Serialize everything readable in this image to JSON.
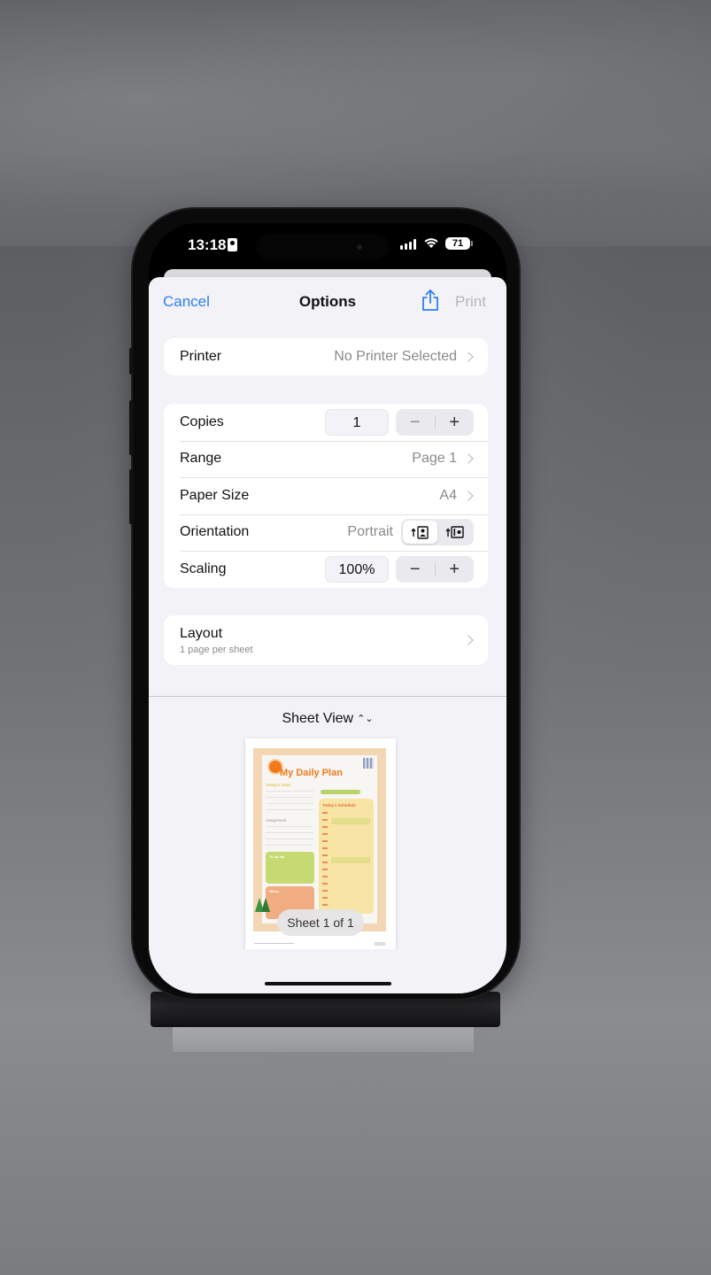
{
  "status_bar": {
    "time": "13:18",
    "battery": "71"
  },
  "nav": {
    "cancel_label": "Cancel",
    "title": "Options",
    "print_label": "Print"
  },
  "printer": {
    "label": "Printer",
    "value": "No Printer Selected"
  },
  "settings": {
    "copies_label": "Copies",
    "copies_value": "1",
    "range_label": "Range",
    "range_value": "Page 1",
    "paper_size_label": "Paper Size",
    "paper_size_value": "A4",
    "orientation_label": "Orientation",
    "orientation_value": "Portrait",
    "scaling_label": "Scaling",
    "scaling_value": "100%",
    "minus_symbol": "−",
    "plus_symbol": "+"
  },
  "layout": {
    "title": "Layout",
    "subtitle": "1 page per sheet"
  },
  "preview": {
    "view_mode": "Sheet View",
    "view_mode_icon": "⌃⌄",
    "document_title": "My Daily Plan",
    "goal_label": "Today's Goal",
    "assignment_label": "Assignment",
    "schedule_label": "Today's Schedule",
    "todo_label": "To do list",
    "notes_label": "Notes",
    "sheet_counter": "Sheet 1 of 1"
  },
  "colors": {
    "accent": "#2f7ff2",
    "disabled": "#b6b6bb",
    "sheet_background": "#f2f2f7",
    "preview_title": "#ef7a1f"
  }
}
